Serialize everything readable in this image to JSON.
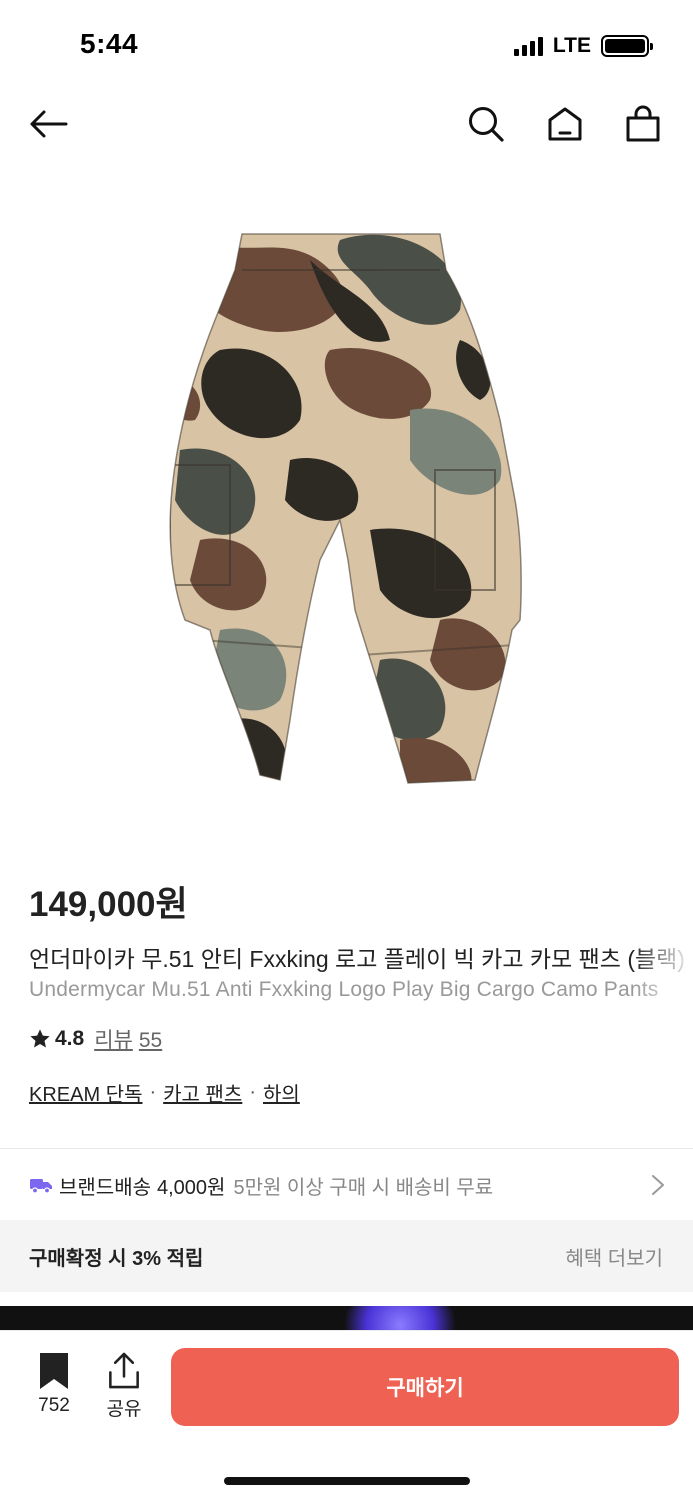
{
  "status_bar": {
    "time": "5:44",
    "network": "LTE",
    "battery_level": 1.0,
    "signal_bars": 4
  },
  "nav": {
    "icons": [
      "back-arrow-icon",
      "search-icon",
      "home-icon",
      "shopping-bag-icon"
    ]
  },
  "product": {
    "image": "camo-cargo-pants-photo",
    "price": "149,000원",
    "title_ko": "언더마이카 무.51 안티 Fxxking 로고 플레이 빅 카고 카모 팬츠 (블랙)",
    "title_en": "Undermycar Mu.51 Anti Fxxking Logo Play Big Cargo Camo Pants",
    "rating": {
      "value": "4.8",
      "review_label": "리뷰",
      "review_count": "55"
    },
    "categories": [
      {
        "label": "KREAM 단독"
      },
      {
        "label": "카고 팬츠"
      },
      {
        "label": "하의"
      }
    ],
    "category_separator": "·"
  },
  "delivery": {
    "label": "브랜드배송",
    "fee": "4,000원",
    "note": "5만원 이상 구매 시 배송비 무료",
    "icon": "truck-icon",
    "icon_color": "#7b68ee"
  },
  "benefit": {
    "label": "구매확정 시 3% 적립",
    "more": "혜택 더보기"
  },
  "bottom": {
    "bookmark_count": "752",
    "share_label": "공유",
    "buy_label": "구매하기",
    "buy_color": "#ef6253"
  }
}
